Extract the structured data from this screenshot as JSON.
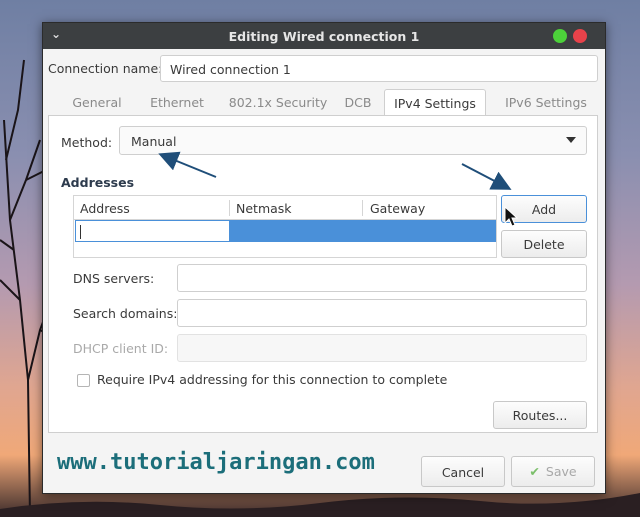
{
  "window": {
    "title": "Editing Wired connection 1",
    "menu_icon": "chevron-down-icon",
    "controls": [
      {
        "name": "maximize",
        "color": "#4cd13a"
      },
      {
        "name": "close",
        "color": "#e8424a"
      }
    ]
  },
  "connection": {
    "label": "Connection name:",
    "value": "Wired connection 1"
  },
  "tabs": [
    {
      "label": "General"
    },
    {
      "label": "Ethernet"
    },
    {
      "label": "802.1x Security"
    },
    {
      "label": "DCB"
    },
    {
      "label": "IPv4 Settings",
      "active": true
    },
    {
      "label": "IPv6 Settings"
    }
  ],
  "ipv4": {
    "method_label": "Method:",
    "method_value": "Manual",
    "addresses_heading": "Addresses",
    "columns": [
      "Address",
      "Netmask",
      "Gateway"
    ],
    "add_button": "Add",
    "delete_button": "Delete",
    "dns_label": "DNS servers:",
    "search_label": "Search domains:",
    "dhcp_label": "DHCP client ID:",
    "require_label": "Require IPv4 addressing for this connection to complete",
    "routes_button": "Routes..."
  },
  "footer": {
    "watermark": "www.tutorialjaringan.com",
    "cancel_button": "Cancel",
    "save_button": "Save"
  },
  "colors": {
    "accent": "#4a90d9",
    "annotation_arrow": "#1f4e79",
    "watermark": "#1c6e7a"
  }
}
